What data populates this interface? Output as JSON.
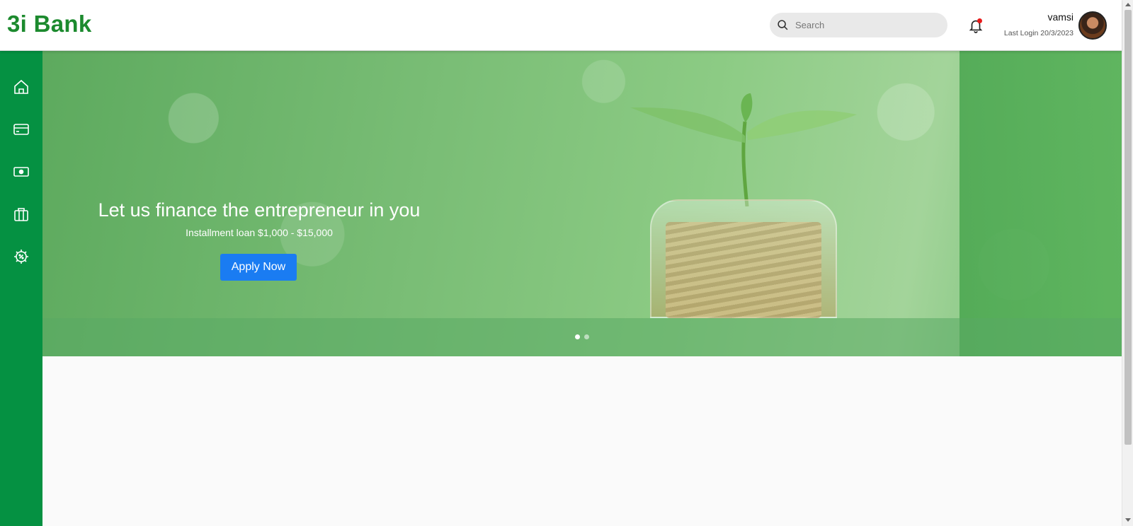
{
  "header": {
    "brand": "3i Bank",
    "search_placeholder": "Search",
    "user_name": "vamsi",
    "last_login": "Last Login 20/3/2023"
  },
  "sidebar": {
    "items": [
      {
        "icon": "home-icon"
      },
      {
        "icon": "card-icon"
      },
      {
        "icon": "cash-icon"
      },
      {
        "icon": "briefcase-icon"
      },
      {
        "icon": "settings-percent-icon"
      }
    ]
  },
  "banner": {
    "title": "Let us finance the entrepreneur in you",
    "subtitle": "Installment loan $1,000 - $15,000",
    "cta": "Apply Now",
    "slides": 2,
    "active_slide": 1
  },
  "colors": {
    "brand_green": "#1c8a2e",
    "sidebar_green": "#059142",
    "cta_blue": "#1a7cf2",
    "notification_dot": "#e81b1b"
  }
}
